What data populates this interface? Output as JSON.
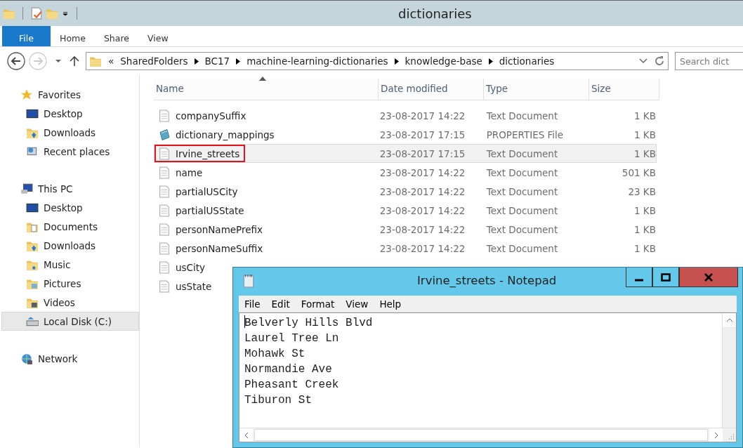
{
  "window": {
    "title": "dictionaries"
  },
  "ribbon_tabs": [
    {
      "label": "File",
      "kind": "file"
    },
    {
      "label": "Home",
      "kind": "tab"
    },
    {
      "label": "Share",
      "kind": "tab"
    },
    {
      "label": "View",
      "kind": "tab"
    }
  ],
  "address_bar": {
    "overflow": "«",
    "path": [
      "SharedFolders",
      "BC17",
      "machine-learning-dictionaries",
      "knowledge-base",
      "dictionaries"
    ]
  },
  "search": {
    "placeholder": "Search dict"
  },
  "sidebar": {
    "groups": [
      {
        "label": "Favorites",
        "kind": "star",
        "children": [
          {
            "label": "Desktop",
            "kind": "desktop",
            "selected": false
          },
          {
            "label": "Downloads",
            "kind": "downloads",
            "selected": false
          },
          {
            "label": "Recent places",
            "kind": "recent",
            "selected": false
          }
        ]
      },
      {
        "label": "This PC",
        "kind": "pc",
        "children": [
          {
            "label": "Desktop",
            "kind": "desktop",
            "selected": false
          },
          {
            "label": "Documents",
            "kind": "documents",
            "selected": false
          },
          {
            "label": "Downloads",
            "kind": "downloads",
            "selected": false
          },
          {
            "label": "Music",
            "kind": "music",
            "selected": false
          },
          {
            "label": "Pictures",
            "kind": "pictures",
            "selected": false
          },
          {
            "label": "Videos",
            "kind": "videos",
            "selected": false
          },
          {
            "label": "Local Disk (C:)",
            "kind": "disk",
            "selected": true
          }
        ]
      },
      {
        "label": "Network",
        "kind": "network"
      }
    ]
  },
  "table": {
    "columns": [
      {
        "label": "Name",
        "sorted": true
      },
      {
        "label": "Date modified",
        "sorted": false
      },
      {
        "label": "Type",
        "sorted": false
      },
      {
        "label": "Size",
        "sorted": false
      }
    ],
    "rows": [
      {
        "name": "companySuffix",
        "date": "23-08-2017 14:22",
        "type": "Text Document",
        "size": "1 KB",
        "kind": "text",
        "selected": false,
        "outlined": false
      },
      {
        "name": "dictionary_mappings",
        "date": "23-08-2017 17:15",
        "type": "PROPERTIES File",
        "size": "1 KB",
        "kind": "properties",
        "selected": false,
        "outlined": false
      },
      {
        "name": "Irvine_streets",
        "date": "23-08-2017 17:15",
        "type": "Text Document",
        "size": "1 KB",
        "kind": "text",
        "selected": true,
        "outlined": true
      },
      {
        "name": "name",
        "date": "23-08-2017 14:22",
        "type": "Text Document",
        "size": "501 KB",
        "kind": "text",
        "selected": false,
        "outlined": false
      },
      {
        "name": "partialUSCity",
        "date": "23-08-2017 14:22",
        "type": "Text Document",
        "size": "23 KB",
        "kind": "text",
        "selected": false,
        "outlined": false
      },
      {
        "name": "partialUSState",
        "date": "23-08-2017 14:22",
        "type": "Text Document",
        "size": "1 KB",
        "kind": "text",
        "selected": false,
        "outlined": false
      },
      {
        "name": "personNamePrefix",
        "date": "23-08-2017 14:22",
        "type": "Text Document",
        "size": "1 KB",
        "kind": "text",
        "selected": false,
        "outlined": false
      },
      {
        "name": "personNameSuffix",
        "date": "23-08-2017 14:22",
        "type": "Text Document",
        "size": "1 KB",
        "kind": "text",
        "selected": false,
        "outlined": false
      },
      {
        "name": "usCity",
        "kind": "text",
        "selected": false,
        "outlined": false
      },
      {
        "name": "usState",
        "kind": "text",
        "selected": false,
        "outlined": false
      }
    ]
  },
  "notepad": {
    "title": "Irvine_streets - Notepad",
    "menu": [
      "File",
      "Edit",
      "Format",
      "View",
      "Help"
    ],
    "lines": [
      "Belverly Hills Blvd",
      "Laurel Tree Ln",
      "Mohawk St",
      "Normandie Ave",
      "Pheasant Creek",
      "Tiburon St"
    ]
  }
}
